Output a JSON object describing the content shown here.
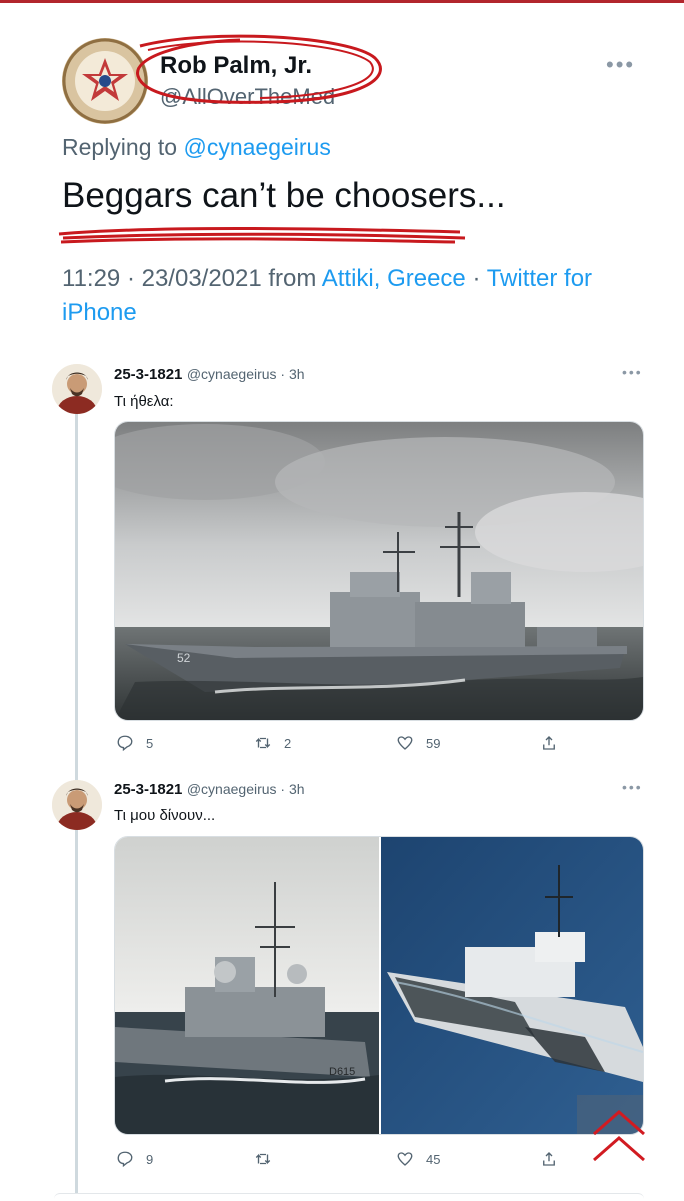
{
  "main_tweet": {
    "name": "Rob Palm, Jr.",
    "handle": "@AllOverTheMed",
    "replying_prefix": "Replying to ",
    "replying_to": "@cynaegeirus",
    "text": "Beggars can’t be choosers...",
    "time": "11:29 · 23/03/2021 from ",
    "location": "Attiki, Greece",
    "separator": " · ",
    "source": "Twitter for iPhone",
    "avatar_badge": "AMERICAN REVOLUTION BICENTENNIAL 1776-1976",
    "menu_icon": "more-icon"
  },
  "replies": [
    {
      "name": "25-3-1821",
      "handle": "@cynaegeirus · 3h",
      "text": "Τι ήθελα:",
      "replies_count": "5",
      "retweets_count": "2",
      "likes_count": "59",
      "hull_number": "52"
    },
    {
      "name": "25-3-1821",
      "handle": "@cynaegeirus · 3h",
      "text": "Τι μου δίνουν...",
      "replies_count": "9",
      "retweets_count": "",
      "likes_count": "45",
      "hull_number": "D615"
    }
  ],
  "colors": {
    "link": "#1d9bf0",
    "muted": "#536471",
    "scribble": "#c8191e",
    "top_bar": "#b2262d"
  }
}
